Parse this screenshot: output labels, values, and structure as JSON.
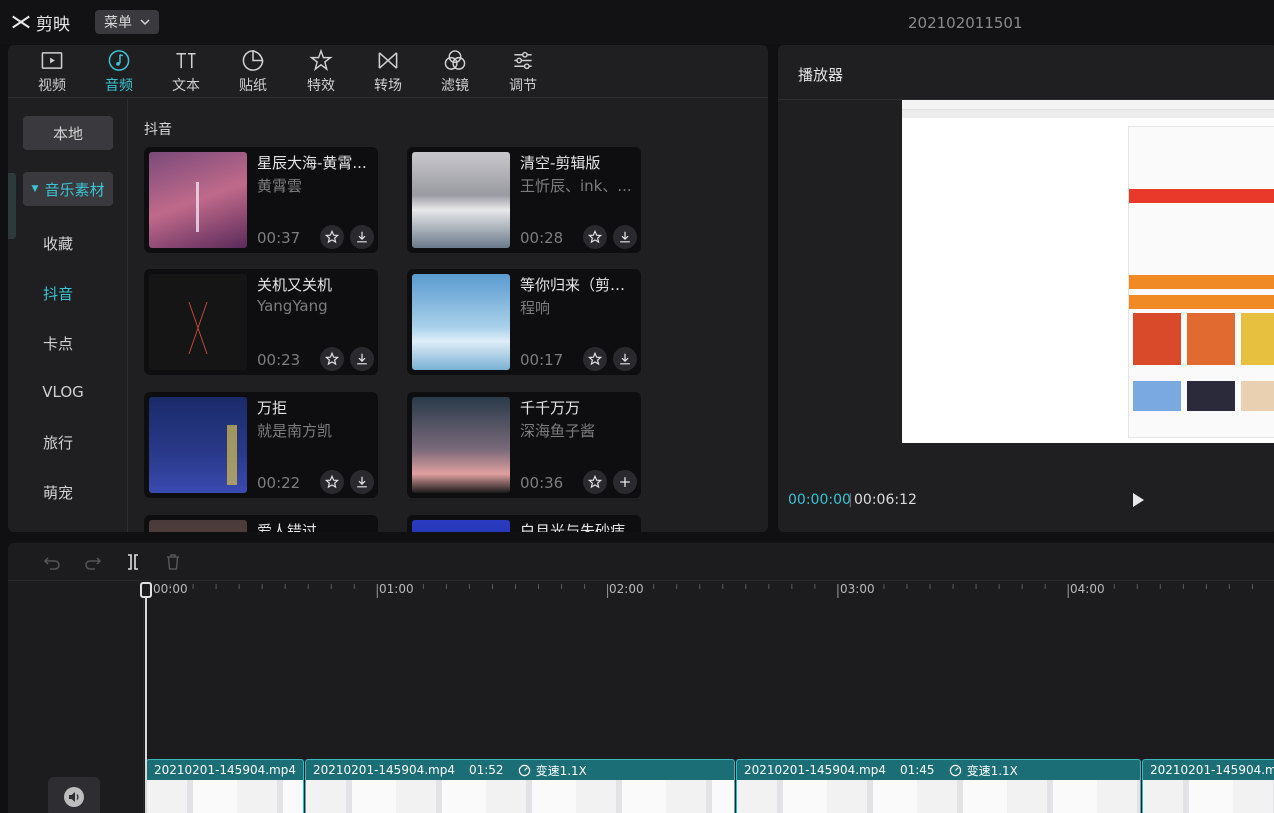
{
  "app": {
    "name": "剪映",
    "menu_label": "菜单",
    "project_title": "202102011501"
  },
  "toolbar": {
    "tabs": [
      {
        "label": "视频",
        "icon": "video-icon"
      },
      {
        "label": "音频",
        "icon": "audio-icon"
      },
      {
        "label": "文本",
        "icon": "text-icon"
      },
      {
        "label": "贴纸",
        "icon": "sticker-icon"
      },
      {
        "label": "特效",
        "icon": "effects-icon"
      },
      {
        "label": "转场",
        "icon": "transition-icon"
      },
      {
        "label": "滤镜",
        "icon": "filter-icon"
      },
      {
        "label": "调节",
        "icon": "adjust-icon"
      }
    ],
    "active_index": 1
  },
  "sidebar": {
    "items": [
      "本地",
      "音乐素材",
      "收藏",
      "抖音",
      "卡点",
      "VLOG",
      "旅行",
      "萌宠"
    ],
    "active": "抖音"
  },
  "library": {
    "section_title": "抖音",
    "tracks": [
      {
        "title": "星辰大海-黄霄...",
        "artist": "黄霄雲",
        "duration": "00:37",
        "action": "download"
      },
      {
        "title": "清空-剪辑版",
        "artist": "王忻辰、ink、...",
        "duration": "00:28",
        "action": "download"
      },
      {
        "title": "关机又关机",
        "artist": "YangYang",
        "duration": "00:23",
        "action": "download"
      },
      {
        "title": "等你归来（剪辑...",
        "artist": "程响",
        "duration": "00:17",
        "action": "download"
      },
      {
        "title": "万拒",
        "artist": "就是南方凯",
        "duration": "00:22",
        "action": "download"
      },
      {
        "title": "千千万万",
        "artist": "深海鱼子酱",
        "duration": "00:36",
        "action": "add"
      },
      {
        "title": "爱人错过",
        "artist": "",
        "duration": "",
        "action": ""
      },
      {
        "title": "白月光与朱砂痣",
        "artist": "",
        "duration": "",
        "action": ""
      }
    ]
  },
  "player": {
    "title": "播放器",
    "current_time": "00:00:00",
    "total_time": "00:06:12"
  },
  "timeline": {
    "ruler_labels": [
      "00:00",
      "01:00",
      "02:00",
      "03:00",
      "04:00"
    ],
    "clips": [
      {
        "name": "20210201-145904.mp4",
        "duration": "",
        "speed": ""
      },
      {
        "name": "20210201-145904.mp4",
        "duration": "01:52",
        "speed": "变速1.1X"
      },
      {
        "name": "20210201-145904.mp4",
        "duration": "01:45",
        "speed": "变速1.1X"
      },
      {
        "name": "20210201-145904.mp4",
        "duration": "",
        "speed": ""
      }
    ]
  },
  "colors": {
    "accent": "#3ac3d3",
    "clip": "#1b6e75"
  }
}
